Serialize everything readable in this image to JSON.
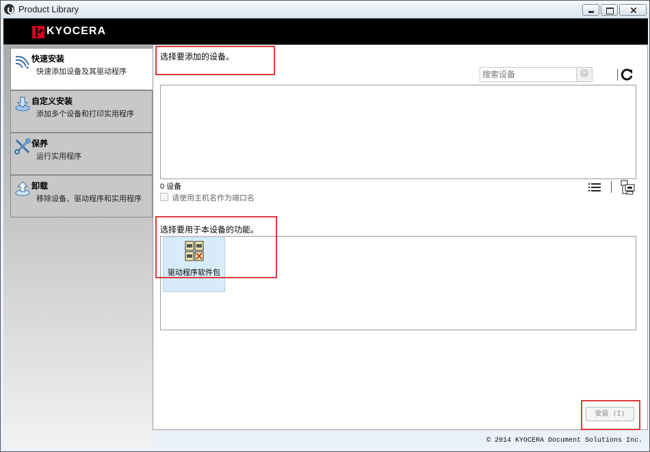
{
  "window": {
    "title": "Product Library",
    "brand": "KYOCERA"
  },
  "sidebar": {
    "items": [
      {
        "title": "快速安装",
        "desc": "快速添加设备及其驱动程序",
        "icon": "quick-install-icon"
      },
      {
        "title": "自定义安装",
        "desc": "添加多个设备和打印实用程序",
        "icon": "custom-install-icon"
      },
      {
        "title": "保养",
        "desc": "运行实用程序",
        "icon": "maintenance-tools-icon"
      },
      {
        "title": "卸载",
        "desc": "移除设备、驱动程序和实用程序",
        "icon": "uninstall-icon"
      }
    ]
  },
  "main": {
    "select_device_label": "选择要添加的设备。",
    "search": {
      "placeholder": "搜索设备",
      "value": ""
    },
    "device_count": "0 设备",
    "hostname_checkbox_label": "请使用主机名作为端口名",
    "hostname_checkbox_checked": false,
    "select_function_label": "选择要用于本设备的功能。",
    "functions": [
      {
        "label": "驱动程序软件包",
        "icon": "driver-package-icon"
      }
    ],
    "install_button": "安装 (I)"
  },
  "footer": {
    "copyright": "© 2014 KYOCERA Document Solutions Inc."
  },
  "colors": {
    "brand_red": "#d1001f",
    "highlight_red": "#e0393b",
    "selected_tile": "#d7ecf8"
  }
}
